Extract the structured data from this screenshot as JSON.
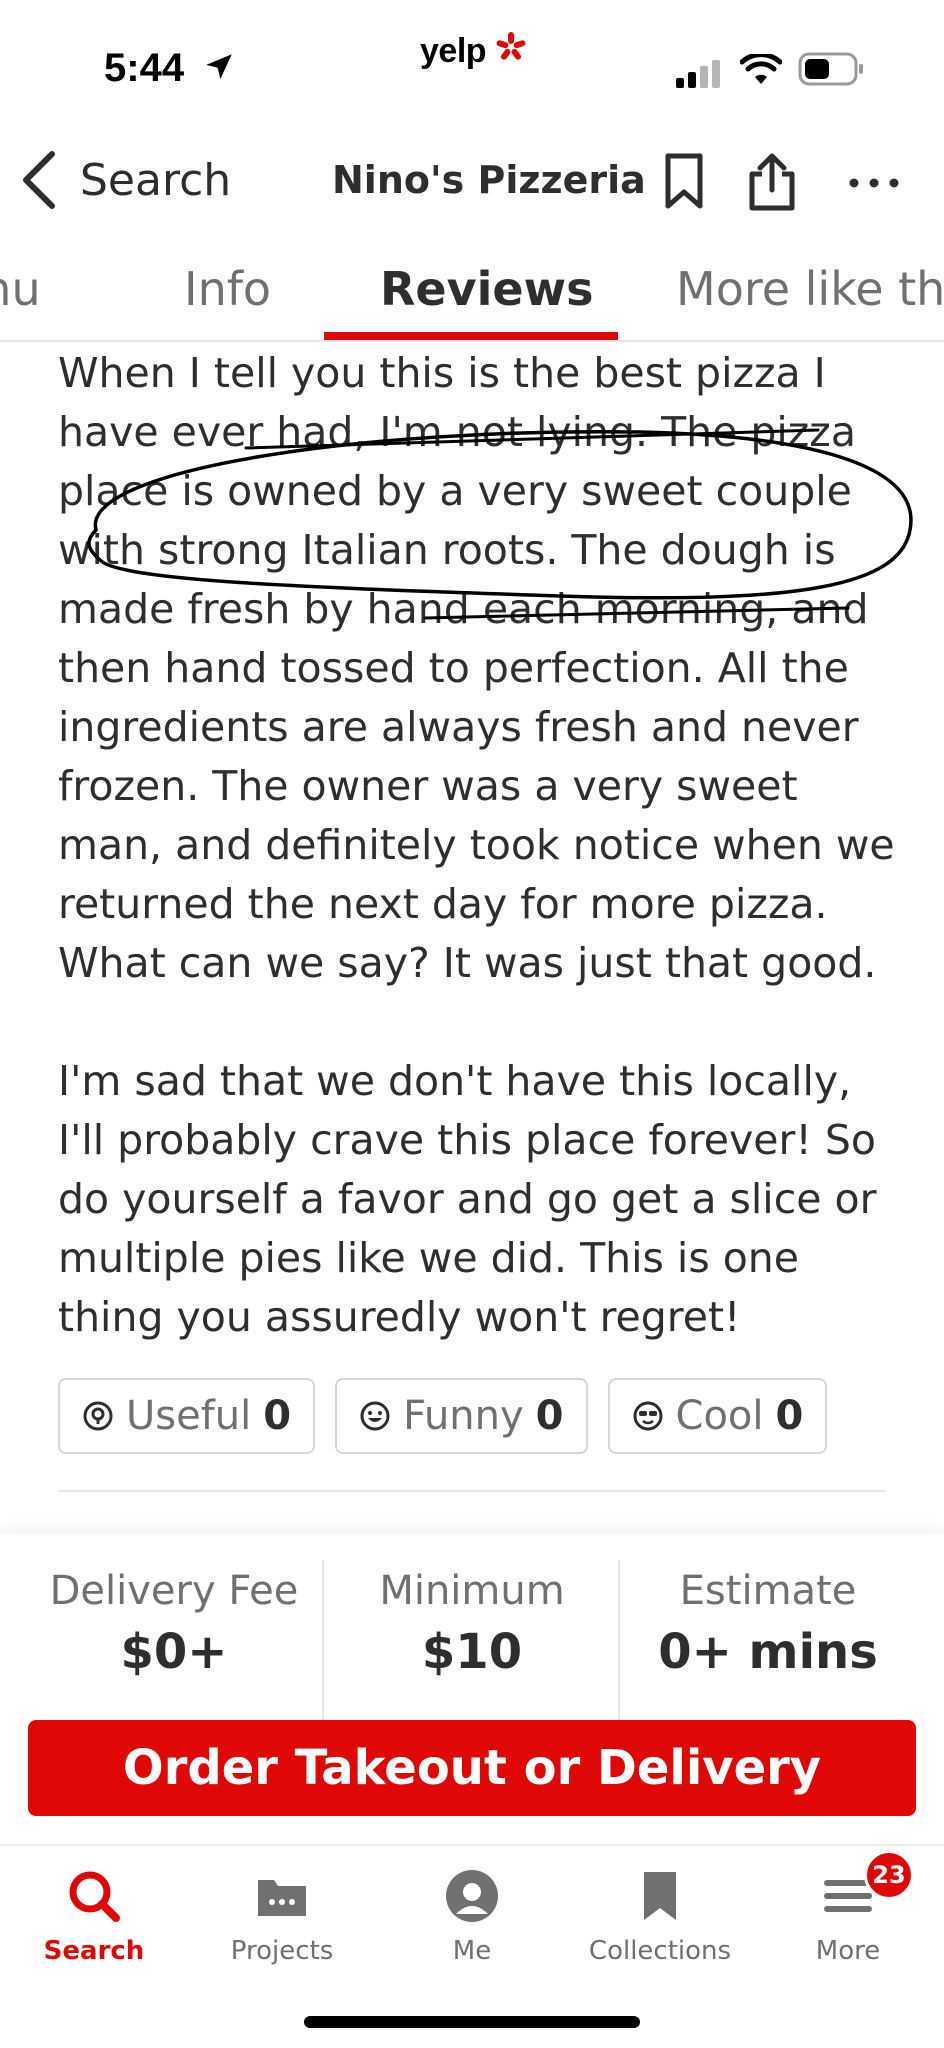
{
  "status_bar": {
    "time": "5:44",
    "carrier_app": "yelp",
    "icons": [
      "location-arrow-icon",
      "yelp-burst-icon",
      "cellular-signal-icon",
      "wifi-icon",
      "battery-icon"
    ]
  },
  "nav": {
    "back_label": "Search",
    "title": "Nino's Pizzeria",
    "icons": [
      "back-chevron-icon",
      "bookmark-icon",
      "share-icon",
      "more-icon"
    ]
  },
  "tabs": [
    {
      "label": "Menu",
      "visible_text": "enu",
      "active": false
    },
    {
      "label": "Info",
      "visible_text": "Info",
      "active": false
    },
    {
      "label": "Reviews",
      "visible_text": "Reviews",
      "active": true
    },
    {
      "label": "More like this",
      "visible_text": "More like th",
      "active": false
    }
  ],
  "review": {
    "paragraphs": [
      "When I tell you this is the best pizza I have ever had, I'm not lying. The pizza place is owned by a very sweet couple with strong Italian roots. The dough is made fresh by hand each morning, and then hand tossed to perfection. All the ingredients are always fresh and never frozen. The owner was a very sweet man, and definitely took notice when we returned the next day for more pizza. What can we say? It was just that good.",
      "I'm sad that we don't have this locally, I'll probably crave this place forever! So do yourself a favor and go get a slice or multiple pies like we did. This is one thing you assuredly won't regret!"
    ]
  },
  "reactions": [
    {
      "label": "Useful",
      "count": "0",
      "icon": "lightbulb-icon"
    },
    {
      "label": "Funny",
      "count": "0",
      "icon": "smiley-icon"
    },
    {
      "label": "Cool",
      "count": "0",
      "icon": "sunglasses-icon"
    }
  ],
  "delivery": {
    "fee_label": "Delivery Fee",
    "fee_value": "$0+",
    "minimum_label": "Minimum",
    "minimum_value": "$10",
    "estimate_label": "Estimate",
    "estimate_value": "0+ mins",
    "order_button": "Order Takeout or Delivery"
  },
  "tab_bar": [
    {
      "label": "Search",
      "icon": "search-icon",
      "active": true
    },
    {
      "label": "Projects",
      "icon": "projects-icon",
      "active": false
    },
    {
      "label": "Me",
      "icon": "profile-icon",
      "active": false
    },
    {
      "label": "Collections",
      "icon": "collections-bookmark-icon",
      "active": false
    },
    {
      "label": "More",
      "icon": "menu-lines-icon",
      "active": false,
      "badge": "23"
    }
  ],
  "colors": {
    "brand_red": "#e00707",
    "text_primary": "#2d2e2f",
    "text_secondary": "#6e7072",
    "border": "#d6d6d6"
  }
}
